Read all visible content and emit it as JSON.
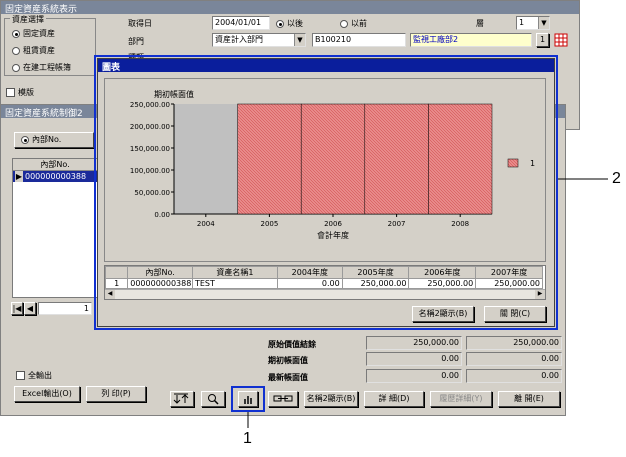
{
  "main_window": {
    "title": "固定資産系統表示",
    "asset_select_group": "資産選擇",
    "asset_options": [
      "固定資産",
      "租賃資産",
      "在建工程帳簿"
    ],
    "asset_selected": 0,
    "template_label": "模版",
    "acq_date_label": "取得日",
    "acq_date_value": "2004/01/01",
    "acq_after_label": "以後",
    "acq_before_label": "以前",
    "layer_label": "層",
    "layer_value": "1",
    "dept_label": "部門",
    "dept_value": "資産計入部門",
    "dept_code": "B100210",
    "dept_name": "監視工廠部2",
    "dept_page": "1",
    "other_label": "種類"
  },
  "list_window": {
    "title": "固定資産系統制御2",
    "radio_label": "內部No.",
    "col_header": "內部No.",
    "row_value": "000000000388",
    "pager_value": "1"
  },
  "summary": {
    "rows": [
      {
        "label": "原始價值結餘",
        "v1": "250,000.00",
        "v2": "250,000.00"
      },
      {
        "label": "期初帳面值",
        "v1": "0.00",
        "v2": "0.00"
      },
      {
        "label": "最新帳面值",
        "v1": "0.00",
        "v2": "0.00"
      }
    ]
  },
  "bottom": {
    "all_output_label": "全輸出",
    "excel_btn": "Excel輸出(O)",
    "print_btn": "列 印(P)",
    "name2_btn": "名稱2顯示(B)",
    "detail_btn": "詳 細(D)",
    "detail2_btn": "履歷詳細(Y)",
    "close_btn": "離 開(E)"
  },
  "chart_window": {
    "title": "圖表",
    "name2_btn": "名稱2顯示(B)",
    "close_btn": "關 閉(C)",
    "table": {
      "headers": [
        "",
        "內部No.",
        "資產名稱1",
        "2004年度",
        "2005年度",
        "2006年度",
        "2007年度"
      ],
      "rows": [
        [
          "1",
          "000000000388",
          "TEST",
          "0.00",
          "250,000.00",
          "250,000.00",
          "250,000.00"
        ]
      ]
    }
  },
  "chart_data": {
    "type": "bar",
    "title": "期初帳面值",
    "xlabel": "會計年度",
    "ylabel": "",
    "categories": [
      "2004",
      "2005",
      "2006",
      "2007",
      "2008"
    ],
    "series": [
      {
        "name": "1",
        "values": [
          0,
          250000,
          250000,
          250000,
          250000
        ]
      }
    ],
    "ylim": [
      0,
      250000
    ],
    "yticks": [
      "0.00",
      "50,000.00",
      "100,000.00",
      "150,000.00",
      "200,000.00",
      "250,000.00"
    ],
    "legend": "right",
    "bar_color": "#e88a8a"
  },
  "callouts": {
    "one": "1",
    "two": "2"
  }
}
